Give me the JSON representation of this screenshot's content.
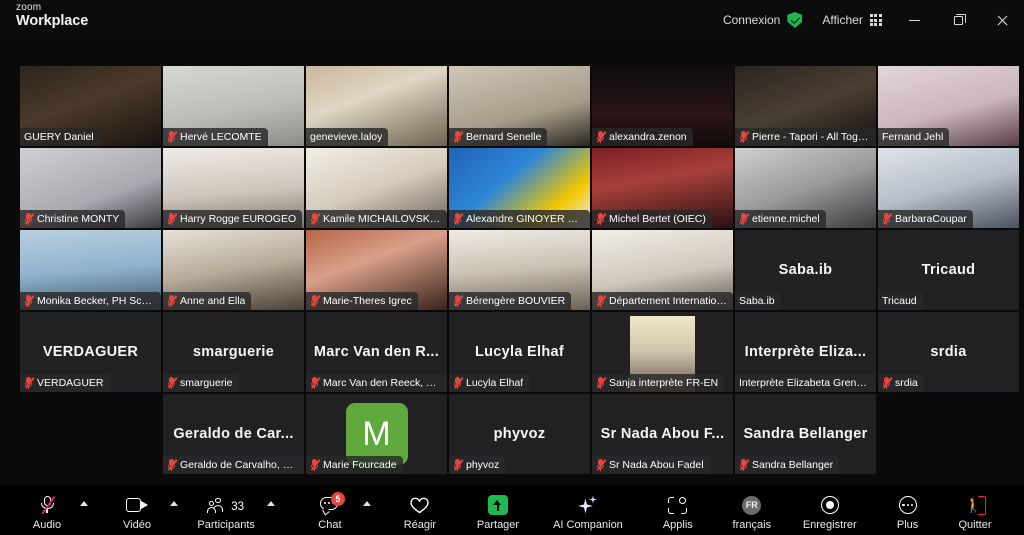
{
  "window": {
    "brand_top": "zoom",
    "brand_bottom": "Workplace",
    "connection_label": "Connexion",
    "view_label": "Afficher",
    "minimize_label": "Réduire",
    "maximize_label": "Agrandir",
    "close_label": "Fermer"
  },
  "theme": {
    "background": "#0a0a0a",
    "tile_background": "#1b1b1d",
    "active_speaker_border": "#3df58b",
    "mute_red": "#e8453c",
    "share_green": "#1eb853",
    "leave_red": "#e0245e",
    "avatar_green": "#5fa83c",
    "badge_red": "#e8453c"
  },
  "gallery": {
    "columns": 7,
    "rows": 5,
    "participants": [
      {
        "name": "GUERY Daniel",
        "muted": false,
        "video": true,
        "active_speaker": false,
        "bg": "bg1",
        "row": 1,
        "col": 1
      },
      {
        "name": "Hervé LECOMTE",
        "muted": true,
        "video": true,
        "active_speaker": false,
        "bg": "bg2",
        "row": 1,
        "col": 2
      },
      {
        "name": "genevieve.laloy",
        "muted": false,
        "video": true,
        "active_speaker": false,
        "bg": "bg3",
        "row": 1,
        "col": 3
      },
      {
        "name": "Bernard Senelle",
        "muted": true,
        "video": true,
        "active_speaker": false,
        "bg": "bg4",
        "row": 1,
        "col": 4
      },
      {
        "name": "alexandra.zenon",
        "muted": true,
        "video": true,
        "active_speaker": false,
        "bg": "bg5",
        "row": 1,
        "col": 5
      },
      {
        "name": "Pierre - Tapori - All Toget...",
        "muted": true,
        "video": true,
        "active_speaker": false,
        "bg": "bg6",
        "row": 1,
        "col": 6
      },
      {
        "name": "Fernand Jehl",
        "muted": false,
        "video": true,
        "active_speaker": true,
        "bg": "bg7",
        "row": 1,
        "col": 7
      },
      {
        "name": "Christine MONTY",
        "muted": true,
        "video": true,
        "active_speaker": false,
        "bg": "bg8",
        "row": 2,
        "col": 1
      },
      {
        "name": "Harry Rogge EUROGEO",
        "muted": true,
        "video": true,
        "active_speaker": false,
        "bg": "bg9",
        "row": 2,
        "col": 2
      },
      {
        "name": "Kamile MICHAILOVSKYTE",
        "muted": true,
        "video": true,
        "active_speaker": false,
        "bg": "bg10",
        "row": 2,
        "col": 3
      },
      {
        "name": "Alexandre GINOYER CMA ...",
        "muted": true,
        "video": true,
        "active_speaker": false,
        "bg": "bg11",
        "row": 2,
        "col": 4
      },
      {
        "name": "Michel Bertet (OIEC)",
        "muted": true,
        "video": true,
        "active_speaker": false,
        "bg": "bg12",
        "row": 2,
        "col": 5
      },
      {
        "name": "etienne.michel",
        "muted": true,
        "video": true,
        "active_speaker": false,
        "bg": "bg13",
        "row": 2,
        "col": 6
      },
      {
        "name": "BarbaraCoupar",
        "muted": true,
        "video": true,
        "active_speaker": false,
        "bg": "bg14",
        "row": 2,
        "col": 7
      },
      {
        "name": "Monika Becker, PH Schw...",
        "muted": true,
        "video": true,
        "active_speaker": false,
        "bg": "bg15",
        "row": 3,
        "col": 1
      },
      {
        "name": "Anne and Ella",
        "muted": true,
        "video": true,
        "active_speaker": false,
        "bg": "bg16",
        "row": 3,
        "col": 2
      },
      {
        "name": "Marie-Theres Igrec",
        "muted": true,
        "video": true,
        "active_speaker": false,
        "bg": "bg17",
        "row": 3,
        "col": 3
      },
      {
        "name": "Bérengère BOUVIER",
        "muted": true,
        "video": true,
        "active_speaker": false,
        "bg": "bg18",
        "row": 3,
        "col": 4
      },
      {
        "name": "Département Internation...",
        "muted": true,
        "video": true,
        "active_speaker": false,
        "bg": "bg19",
        "row": 3,
        "col": 5
      },
      {
        "name": "Saba.ib",
        "display_name": "Saba.ib",
        "muted": false,
        "video": false,
        "active_speaker": false,
        "row": 3,
        "col": 6
      },
      {
        "name": "Tricaud",
        "display_name": "Tricaud",
        "muted": false,
        "video": false,
        "active_speaker": false,
        "row": 3,
        "col": 7
      },
      {
        "name": "VERDAGUER",
        "display_name": "VERDAGUER",
        "muted": true,
        "video": false,
        "active_speaker": false,
        "row": 4,
        "col": 1
      },
      {
        "name": "smarguerie",
        "display_name": "smarguerie",
        "muted": true,
        "video": false,
        "active_speaker": false,
        "row": 4,
        "col": 2
      },
      {
        "name": "Marc Van den Reeck, The ...",
        "display_name": "Marc Van den R...",
        "muted": true,
        "video": false,
        "active_speaker": false,
        "row": 4,
        "col": 3
      },
      {
        "name": "Lucyla Elhaf",
        "display_name": "Lucyla Elhaf",
        "muted": true,
        "video": false,
        "active_speaker": false,
        "row": 4,
        "col": 4
      },
      {
        "name": "Sanja interprète FR-EN",
        "muted": true,
        "video": true,
        "active_speaker": false,
        "bg": "bg22",
        "row": 4,
        "col": 5
      },
      {
        "name": "Interprète Elizabeta Greneron",
        "display_name": "Interprète  Eliza...",
        "muted": false,
        "video": false,
        "active_speaker": false,
        "row": 4,
        "col": 6
      },
      {
        "name": "srdia",
        "display_name": "srdia",
        "muted": true,
        "video": false,
        "active_speaker": false,
        "row": 4,
        "col": 7
      },
      {
        "name": "Geraldo de Carvalho, FIPLV",
        "display_name": "Geraldo de Car...",
        "muted": true,
        "video": false,
        "active_speaker": false,
        "row": 5,
        "col": 2
      },
      {
        "name": "Marie Fourcade",
        "initial": "M",
        "muted": true,
        "video": false,
        "active_speaker": false,
        "row": 5,
        "col": 3
      },
      {
        "name": "phyvoz",
        "display_name": "phyvoz",
        "muted": true,
        "video": false,
        "active_speaker": false,
        "row": 5,
        "col": 4
      },
      {
        "name": "Sr Nada Abou Fadel",
        "display_name": "Sr Nada Abou F...",
        "muted": true,
        "video": false,
        "active_speaker": false,
        "row": 5,
        "col": 5
      },
      {
        "name": "Sandra Bellanger",
        "display_name": "Sandra Bellanger",
        "muted": true,
        "video": false,
        "active_speaker": false,
        "row": 5,
        "col": 6
      }
    ]
  },
  "toolbar": {
    "audio_label": "Audio",
    "audio_muted": true,
    "video_label": "Vidéo",
    "participants_label": "Participants",
    "participants_count": "33",
    "chat_label": "Chat",
    "chat_badge": "5",
    "react_label": "Réagir",
    "share_label": "Partager",
    "ai_label": "AI Companion",
    "apps_label": "Applis",
    "language_label": "français",
    "language_code": "FR",
    "record_label": "Enregistrer",
    "more_label": "Plus",
    "leave_label": "Quitter"
  }
}
